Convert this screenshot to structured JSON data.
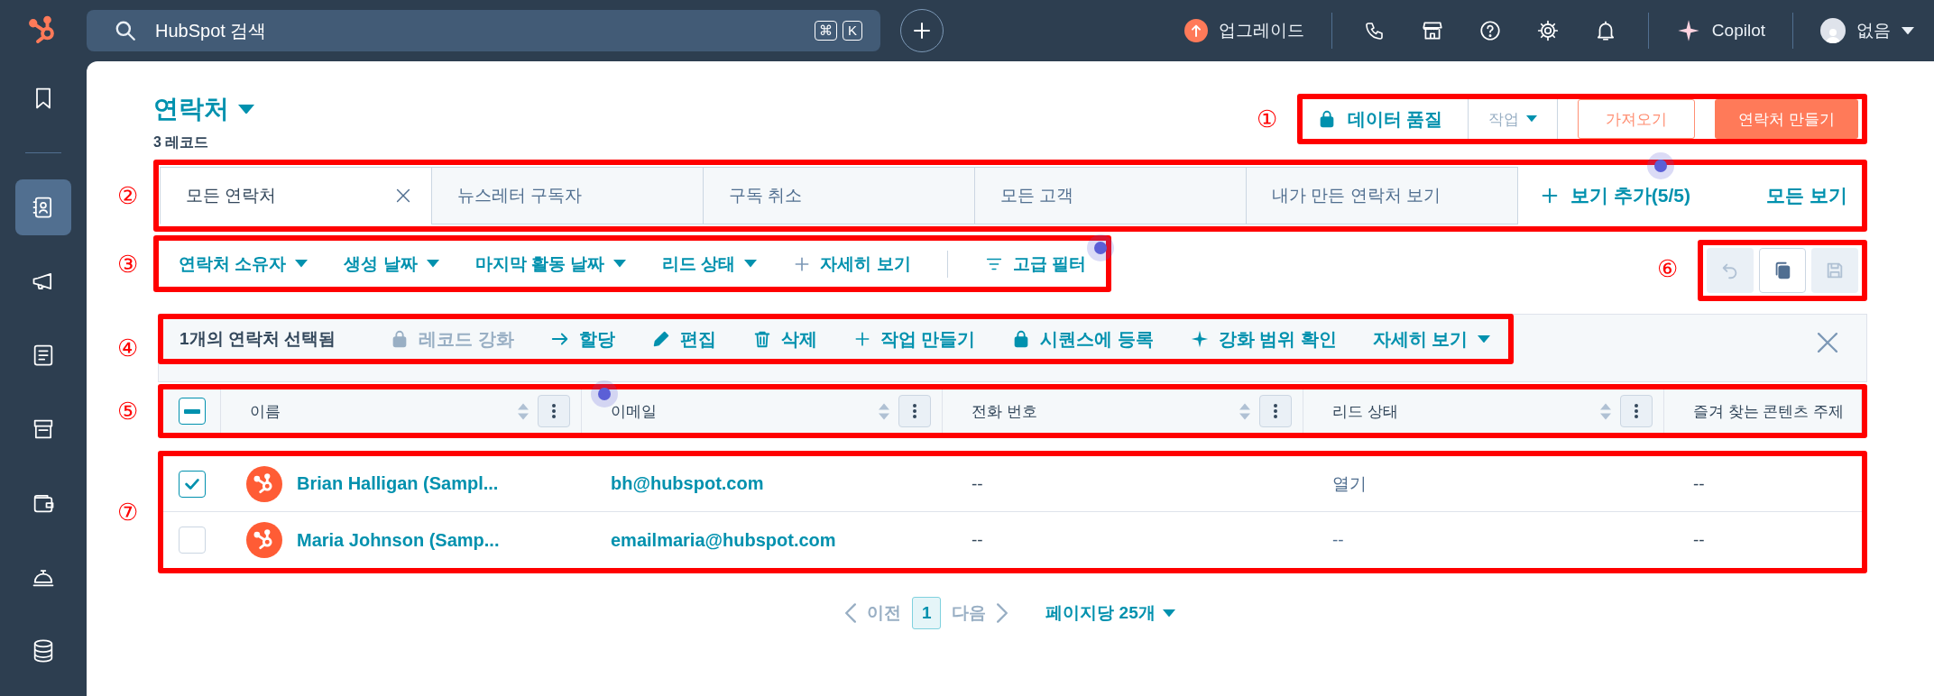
{
  "top_bar": {
    "search": {
      "placeholder": "HubSpot 검색"
    },
    "shortcut_keys": [
      "⌘",
      "K"
    ],
    "upgrade": "업그레이드",
    "copilot": "Copilot",
    "account": "없음"
  },
  "sidebar": {
    "items": [
      {
        "selected": false
      },
      {
        "selected": true
      },
      {
        "selected": false
      },
      {
        "selected": false
      },
      {
        "selected": false
      },
      {
        "selected": false
      },
      {
        "selected": false
      },
      {
        "selected": false
      }
    ]
  },
  "page_header": {
    "title": "연락처",
    "record_count": "3 레코드"
  },
  "actions": {
    "annotation": "①",
    "data_quality": "데이터 품질",
    "actions_menu": "작업",
    "import": "가져오기",
    "create": "연락처 만들기"
  },
  "views": {
    "annotation": "②",
    "tabs": [
      {
        "label": "모든 연락처",
        "selected": true,
        "closable": true
      },
      {
        "label": "뉴스레터 구독자",
        "selected": false,
        "closable": false
      },
      {
        "label": "구독 취소",
        "selected": false,
        "closable": false
      },
      {
        "label": "모든 고객",
        "selected": false,
        "closable": false
      },
      {
        "label": "내가 만든 연락처 보기",
        "selected": false,
        "closable": false
      }
    ],
    "add_view": "보기 추가(5/5)",
    "all_views": "모든 보기"
  },
  "filters": {
    "annotation": "③",
    "items": [
      {
        "label": "연락처 소유자",
        "kind": "dropdown"
      },
      {
        "label": "생성 날짜",
        "kind": "dropdown"
      },
      {
        "label": "마지막 활동 날짜",
        "kind": "dropdown"
      },
      {
        "label": "리드 상태",
        "kind": "dropdown"
      },
      {
        "label": "자세히 보기",
        "kind": "add"
      },
      {
        "label": "고급 필터",
        "kind": "advanced"
      }
    ]
  },
  "view_tools": {
    "annotation": "⑥",
    "buttons": [
      {
        "kind": "undo",
        "disabled": true
      },
      {
        "kind": "clone",
        "disabled": false
      },
      {
        "kind": "save",
        "disabled": true
      }
    ]
  },
  "bulk_actions": {
    "annotation": "④",
    "selection_count": "1개의 연락처 선택됨",
    "actions": [
      {
        "label": "레코드 강화",
        "kind": "lock",
        "disabled": true
      },
      {
        "label": "할당",
        "kind": "arrow",
        "disabled": false
      },
      {
        "label": "편집",
        "kind": "pencil",
        "disabled": false
      },
      {
        "label": "삭제",
        "kind": "trash",
        "disabled": false
      },
      {
        "label": "작업 만들기",
        "kind": "plus",
        "disabled": false
      },
      {
        "label": "시퀀스에 등록",
        "kind": "lock",
        "disabled": false
      },
      {
        "label": "강화 범위 확인",
        "kind": "sparkle",
        "disabled": false
      },
      {
        "label": "자세히 보기",
        "kind": "dropdown",
        "disabled": false
      }
    ]
  },
  "table": {
    "header_annotation": "⑤",
    "rows_annotation": "⑦",
    "header_checkbox": {
      "indeterminate": true
    },
    "columns": [
      {
        "label": "이름",
        "sortable": true
      },
      {
        "label": "이메일",
        "sortable": true
      },
      {
        "label": "전화 번호",
        "sortable": true
      },
      {
        "label": "리드 상태",
        "sortable": true
      },
      {
        "label": "즐겨 찾는 콘텐츠 주제",
        "sortable": false
      }
    ],
    "rows": [
      {
        "selected": true,
        "name": "Brian Halligan (Sampl...",
        "email": "bh@hubspot.com",
        "phone": "--",
        "lead_status": "열기",
        "favorite_content_topic": "--"
      },
      {
        "selected": false,
        "name": "Maria Johnson (Samp...",
        "email": "emailmaria@hubspot.com",
        "phone": "--",
        "lead_status": "--",
        "favorite_content_topic": "--"
      }
    ]
  },
  "pagination": {
    "previous": {
      "label": "이전",
      "disabled": true
    },
    "pages": [
      {
        "label": "1",
        "selected": true
      }
    ],
    "next": {
      "label": "다음",
      "disabled": true
    },
    "per_page": "페이지당 **25개**"
  }
}
